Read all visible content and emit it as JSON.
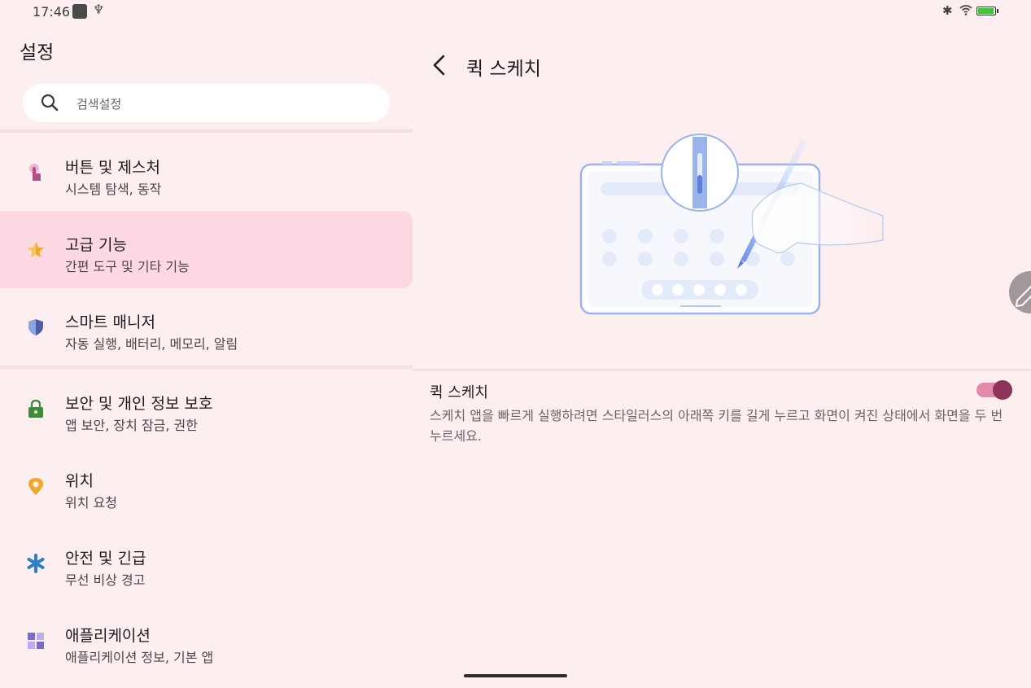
{
  "status_bar": {
    "time": "17:46",
    "usb_glyph": "♆",
    "bluetooth_glyph": "✱",
    "battery_level": 1.0
  },
  "left_panel": {
    "title": "설정",
    "search_placeholder": "검색설정",
    "items": [
      {
        "title": "버튼 및 제스처",
        "subtitle": "시스템 탐색, 동작",
        "icon": "gesture-touch-icon",
        "color": "#b44f8c"
      },
      {
        "title": "고급 기능",
        "subtitle": "간편 도구 및 기타 기능",
        "icon": "star-icon",
        "color": "#f0a830",
        "selected": true
      },
      {
        "title": "스마트 매니저",
        "subtitle": "자동 실행, 배터리, 메모리, 알림",
        "icon": "shield-icon",
        "color": "#4b5fa8"
      },
      {
        "title": "보안 및 개인 정보 보호",
        "subtitle": "앱 보안, 장치 잠금, 권한",
        "icon": "lock-icon",
        "color": "#3f8a3a"
      },
      {
        "title": "위치",
        "subtitle": "위치 요청",
        "icon": "location-pin-icon",
        "color": "#f0a830"
      },
      {
        "title": "안전 및 긴급",
        "subtitle": "무선 비상 경고",
        "icon": "asterisk-icon",
        "color": "#2f7fc4"
      },
      {
        "title": "애플리케이션",
        "subtitle": "애플리케이션 정보, 기본 앱",
        "icon": "apps-grid-icon",
        "color": "#7b6bc9"
      }
    ]
  },
  "right_panel": {
    "title": "퀵 스케치",
    "setting": {
      "title": "퀵 스케치",
      "description": "스케치 앱을 빠르게 실행하려면 스타일러스의 아래쪽 키를 길게 누르고 화면이 켜진 상태에서 화면을 두 번 누르세요.",
      "enabled": true
    }
  },
  "colors": {
    "background": "#fdeef0",
    "selected_item": "#fcd9e2",
    "toggle_track": "#e18aa9",
    "toggle_thumb": "#8e3459"
  }
}
